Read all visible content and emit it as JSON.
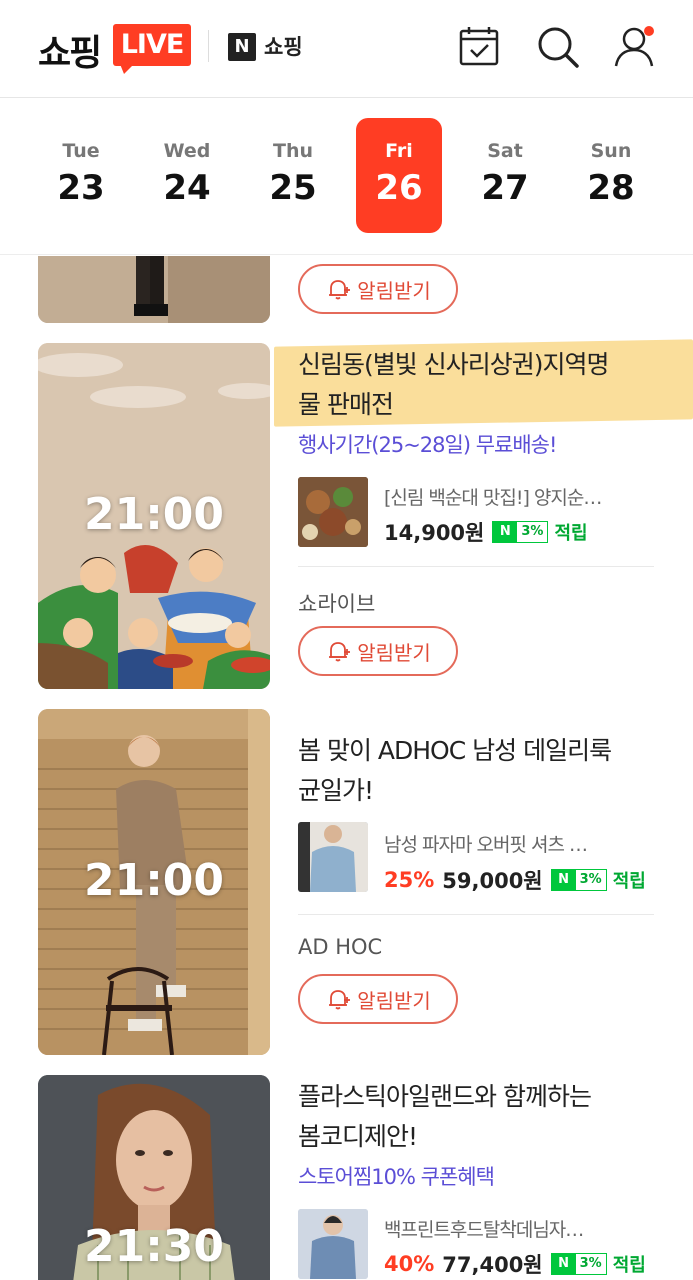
{
  "header": {
    "logo_text": "쇼핑",
    "logo_live": "LIVE",
    "n_badge": "N",
    "n_label": "쇼핑",
    "icons": [
      "calendar-check-icon",
      "search-icon",
      "user-icon"
    ]
  },
  "days": [
    {
      "weekday": "Tue",
      "date": "23"
    },
    {
      "weekday": "Wed",
      "date": "24"
    },
    {
      "weekday": "Thu",
      "date": "25"
    },
    {
      "weekday": "Fri",
      "date": "26",
      "selected": true
    },
    {
      "weekday": "Sat",
      "date": "27"
    },
    {
      "weekday": "Sun",
      "date": "28"
    }
  ],
  "items": [
    {
      "notify_label": "알림받기"
    },
    {
      "time": "21:00",
      "title": "신림동(별빛 신사리상권)지역명물 판매전",
      "title_line1": "신림동(별빛 신사리상권)지역명",
      "title_line2": "물 판매전",
      "promo": "행사기간(25~28일) 무료배송!",
      "product_name": "[신림 백순대 맛집!] 양지순…",
      "price": "14,900원",
      "npay_badge": "N",
      "npay_pct": "3%",
      "npay_label": "적립",
      "seller": "쇼라이브",
      "notify_label": "알림받기"
    },
    {
      "time": "21:00",
      "title_line1": "봄 맞이 ADHOC 남성 데일리룩",
      "title_line2": "균일가!",
      "product_name": "남성 파자마 오버핏 셔츠 …",
      "discount": "25%",
      "price": "59,000원",
      "npay_badge": "N",
      "npay_pct": "3%",
      "npay_label": "적립",
      "seller": "AD HOC",
      "notify_label": "알림받기"
    },
    {
      "time": "21:30",
      "title_line1": "플라스틱아일랜드와 함께하는",
      "title_line2": "봄코디제안!",
      "promo": "스토어찜10% 쿠폰혜택",
      "product_name": "백프린트후드탈착데님자…",
      "discount": "40%",
      "price": "77,400원",
      "npay_badge": "N",
      "npay_pct": "3%",
      "npay_label": "적립"
    }
  ],
  "colors": {
    "accent": "#ff3d23",
    "promo": "#5b4ed6",
    "npay": "#00c73c"
  }
}
